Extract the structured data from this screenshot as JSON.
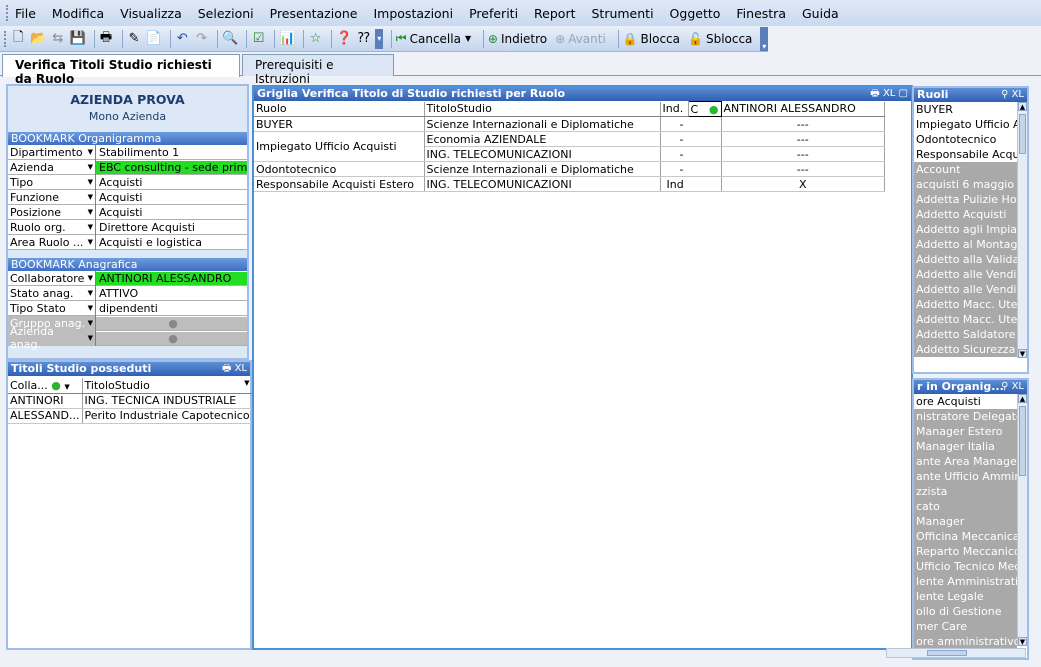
{
  "menu": [
    "File",
    "Modifica",
    "Visualizza",
    "Selezioni",
    "Presentazione",
    "Impostazioni",
    "Preferiti",
    "Report",
    "Strumenti",
    "Oggetto",
    "Finestra",
    "Guida"
  ],
  "toolbar": {
    "cancella": "Cancella",
    "indietro": "Indietro",
    "avanti": "Avanti",
    "blocca": "Blocca",
    "sblocca": "Sblocca"
  },
  "tabs": [
    "Verifica Titoli Studio richiesti da Ruolo",
    "Prerequisiti e Istruzioni"
  ],
  "company": {
    "name": "AZIENDA PROVA",
    "sub": "Mono Azienda"
  },
  "bookmark_org": {
    "title": "BOOKMARK Organigramma",
    "rows": [
      {
        "label": "Dipartimento",
        "value": "Stabilimento 1"
      },
      {
        "label": "Azienda",
        "value": "EBC consulting - sede primaria"
      },
      {
        "label": "Tipo",
        "value": "Acquisti"
      },
      {
        "label": "Funzione",
        "value": "Acquisti"
      },
      {
        "label": "Posizione",
        "value": "Acquisti"
      },
      {
        "label": "Ruolo org.",
        "value": "Direttore Acquisti"
      },
      {
        "label": "Area Ruolo ...",
        "value": "Acquisti e logistica"
      }
    ]
  },
  "bookmark_ana": {
    "title": "BOOKMARK Anagrafica",
    "rows": [
      {
        "label": "Collaboratore",
        "value": "ANTINORI ALESSANDRO"
      },
      {
        "label": "Stato anag.",
        "value": "ATTIVO"
      },
      {
        "label": "Tipo Stato",
        "value": "dipendenti"
      },
      {
        "label": "Gruppo anag.",
        "value": ""
      },
      {
        "label": "Azienda anag.",
        "value": ""
      }
    ]
  },
  "titoli_posseduti": {
    "title": "Titoli Studio posseduti",
    "xl": "XL",
    "headers": [
      "Colla...",
      "TitoloStudio",
      "."
    ],
    "rows": [
      {
        "c": "ANTINORI",
        "t": "ING. TECNICA INDUSTRIALE",
        "d": "."
      },
      {
        "c": "ALESSAND...",
        "t": "Perito Industriale Capotecnico",
        "d": "."
      }
    ]
  },
  "griglia": {
    "title": "Griglia Verifica Titolo di Studio richiesti per Ruolo",
    "xl": "XL",
    "headers": {
      "ruolo": "Ruolo",
      "titolo": "TitoloStudio",
      "ind": "Ind.",
      "c": "C",
      "person": "ANTINORI ALESSANDRO"
    },
    "rows": [
      {
        "ruolo": "BUYER",
        "titolo": "Scienze Internazionali e Diplomatiche",
        "ind": "-",
        "val": "---"
      },
      {
        "ruolo": "Impiegato Ufficio Acquisti",
        "titolo": "Economia AZIENDALE",
        "ind": "-",
        "val": "---"
      },
      {
        "ruolo": "",
        "titolo": "ING. TELECOMUNICAZIONI",
        "ind": "-",
        "val": "---"
      },
      {
        "ruolo": "Odontotecnico",
        "titolo": "Scienze Internazionali e Diplomatiche",
        "ind": "-",
        "val": "---"
      },
      {
        "ruolo": "Responsabile Acquisti Estero",
        "titolo": "ING. TELECOMUNICAZIONI",
        "ind": "Ind",
        "val": "X"
      }
    ]
  },
  "ruoli": {
    "title": "Ruoli",
    "xl": "XL",
    "items": [
      {
        "t": "BUYER",
        "g": false
      },
      {
        "t": "Impiegato Ufficio Acq",
        "g": false
      },
      {
        "t": "Odontotecnico",
        "g": false
      },
      {
        "t": "Responsabile Acquisti",
        "g": false
      },
      {
        "t": "Account",
        "g": true
      },
      {
        "t": "acquisti 6 maggio",
        "g": true
      },
      {
        "t": "Addetta Pulizie Hotel",
        "g": true
      },
      {
        "t": "Addetto Acquisti",
        "g": true
      },
      {
        "t": "Addetto agli Impianti",
        "g": true
      },
      {
        "t": "Addetto al Montaggio",
        "g": true
      },
      {
        "t": "Addetto alla Validazio",
        "g": true
      },
      {
        "t": "Addetto alle Vendite -",
        "g": true
      },
      {
        "t": "Addetto alle Vendite C",
        "g": true
      },
      {
        "t": "Addetto Macc. Utensi",
        "g": true
      },
      {
        "t": "Addetto Macc. Utensi",
        "g": true
      },
      {
        "t": "Addetto Saldatore",
        "g": true
      },
      {
        "t": "Addetto Sicurezza",
        "g": true
      }
    ]
  },
  "organig": {
    "title": "r in Organig...",
    "xl": "XL",
    "items": [
      {
        "t": "ore Acquisti",
        "g": false
      },
      {
        "t": "nistratore Delegato",
        "g": true
      },
      {
        "t": "Manager Estero",
        "g": true
      },
      {
        "t": "Manager Italia",
        "g": true
      },
      {
        "t": "ante Area Manager",
        "g": true
      },
      {
        "t": "ante Ufficio Amministra",
        "g": true
      },
      {
        "t": "zzista",
        "g": true
      },
      {
        "t": "cato",
        "g": true
      },
      {
        "t": " Manager",
        "g": true
      },
      {
        "t": "Officina Meccanica",
        "g": true
      },
      {
        "t": "Reparto Meccanico",
        "g": true
      },
      {
        "t": "Ufficio Tecnico Mecca",
        "g": true
      },
      {
        "t": "lente Amministrativo",
        "g": true
      },
      {
        "t": "lente Legale",
        "g": true
      },
      {
        "t": "ollo di Gestione",
        "g": true
      },
      {
        "t": "mer Care",
        "g": true
      },
      {
        "t": "ore amministrativo",
        "g": true
      }
    ]
  }
}
